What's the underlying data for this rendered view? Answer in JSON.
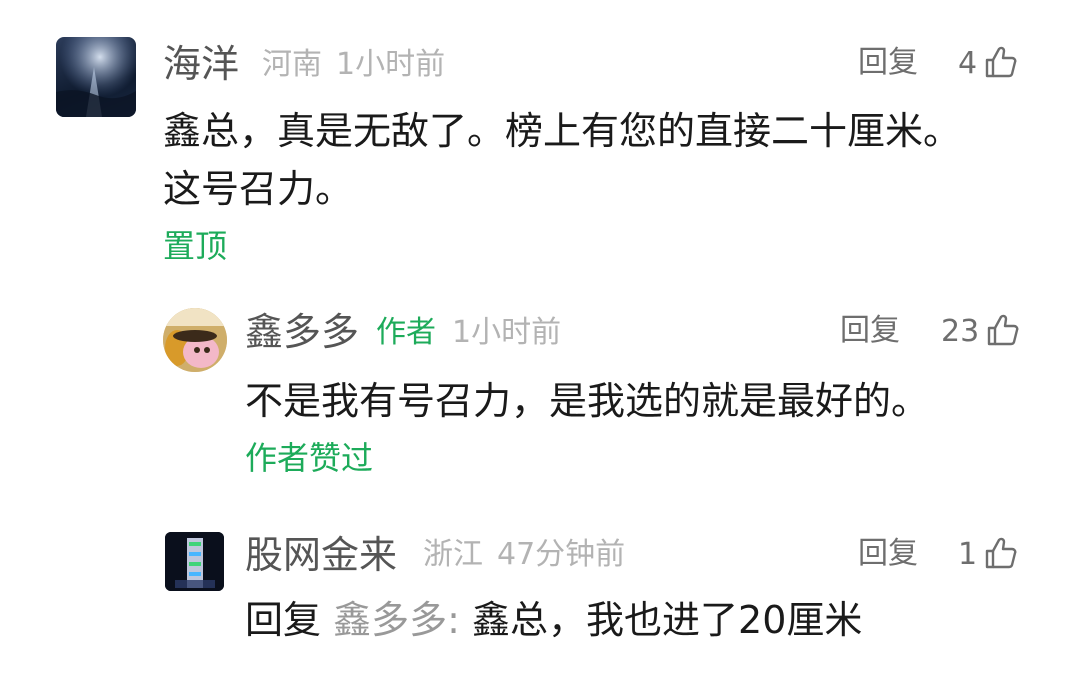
{
  "comments": [
    {
      "name": "海洋",
      "location": "河南",
      "time": "1小时前",
      "reply_label": "回复",
      "likes": "4",
      "content_lines": [
        "鑫总，真是无敌了。榜上有您的直接二十厘米。",
        "这号召力。"
      ],
      "pinned_label": "置顶"
    },
    {
      "name": "鑫多多",
      "author_tag": "作者",
      "time": "1小时前",
      "reply_label": "回复",
      "likes": "23",
      "content": "不是我有号召力，是我选的就是最好的。",
      "author_liked_label": "作者赞过"
    },
    {
      "name": "股网金来",
      "location": "浙江",
      "time": "47分钟前",
      "reply_label": "回复",
      "likes": "1",
      "reply_prefix": "回复",
      "reply_target": "鑫多多:",
      "content": "鑫总，我也进了20厘米"
    }
  ],
  "colors": {
    "green": "#1dab5a",
    "meta_gray": "#b3b3b3",
    "name_gray": "#555555"
  },
  "icons": {
    "like": "thumbs-up-icon"
  }
}
